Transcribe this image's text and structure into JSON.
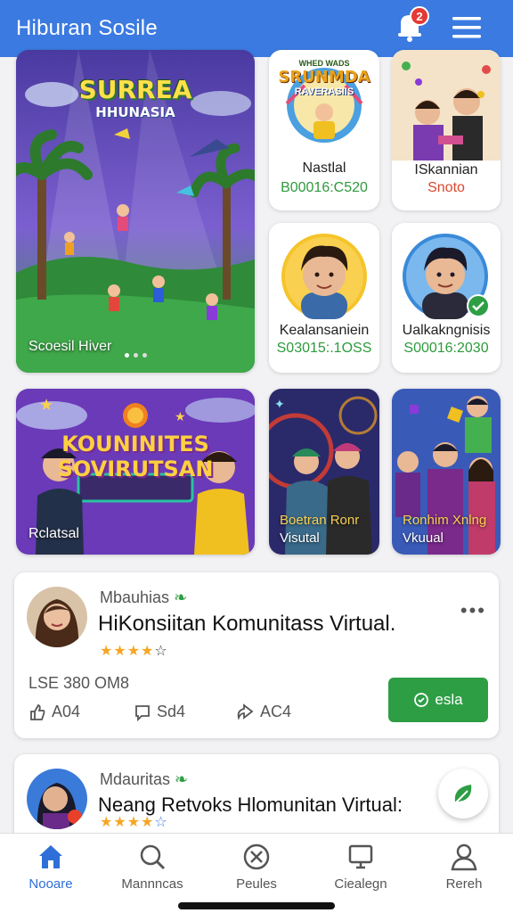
{
  "app": {
    "title": "Hiburan Sosile",
    "notifications": "2"
  },
  "colors": {
    "appbar": "#3b7ae0",
    "accent_green": "#2e9e45",
    "nav_active": "#2f6fd8",
    "star": "#f5a623"
  },
  "featured": {
    "image_text_1": "SURREA",
    "image_text_2": "HHUNASIA",
    "label": "Scoesil Hiver"
  },
  "cards": [
    {
      "name": "Nastlal",
      "code": "B00016:C520",
      "art_text_1": "WHED WADS",
      "art_text_2": "SRUNMDA",
      "art_text_3": "RAVERASIIS"
    },
    {
      "name": "ISkannian",
      "code": "Snoto"
    },
    {
      "name": "Kealansaniein",
      "code": "S03015:.1OSS"
    },
    {
      "name": "Ualkakngnisis",
      "code": "S00016:2030"
    }
  ],
  "banner": {
    "image_text_1": "KOUNINITES",
    "image_text_2": "SOVIRUTSAN",
    "label": "Rclatsal"
  },
  "tiles": [
    {
      "line1": "Boetran Ronr",
      "line2": "Visutal"
    },
    {
      "line1": "Ronhim Xnlng",
      "line2": "Vkuual"
    }
  ],
  "posts": [
    {
      "author": "Mbauhias",
      "title": "HiKonsiitan Komunitass Virtual.",
      "stars": "★★★★",
      "stars_empty": "☆",
      "meta": "LSE 380 OM8",
      "likes": "A04",
      "comments": "Sd4",
      "shares": "AC4",
      "button": "esla"
    },
    {
      "author": "Mdauritas",
      "title": "Neang Retvoks Hlomunitan Virtual:",
      "stars": "★★★★",
      "stars_empty": "☆"
    }
  ],
  "nav": [
    {
      "label": "Nooare",
      "icon": "home-icon",
      "active": true
    },
    {
      "label": "Mannncas",
      "icon": "search-icon"
    },
    {
      "label": "Peules",
      "icon": "tools-icon"
    },
    {
      "label": "Ciealegn",
      "icon": "monitor-icon"
    },
    {
      "label": "Rereh",
      "icon": "profile-icon"
    }
  ]
}
